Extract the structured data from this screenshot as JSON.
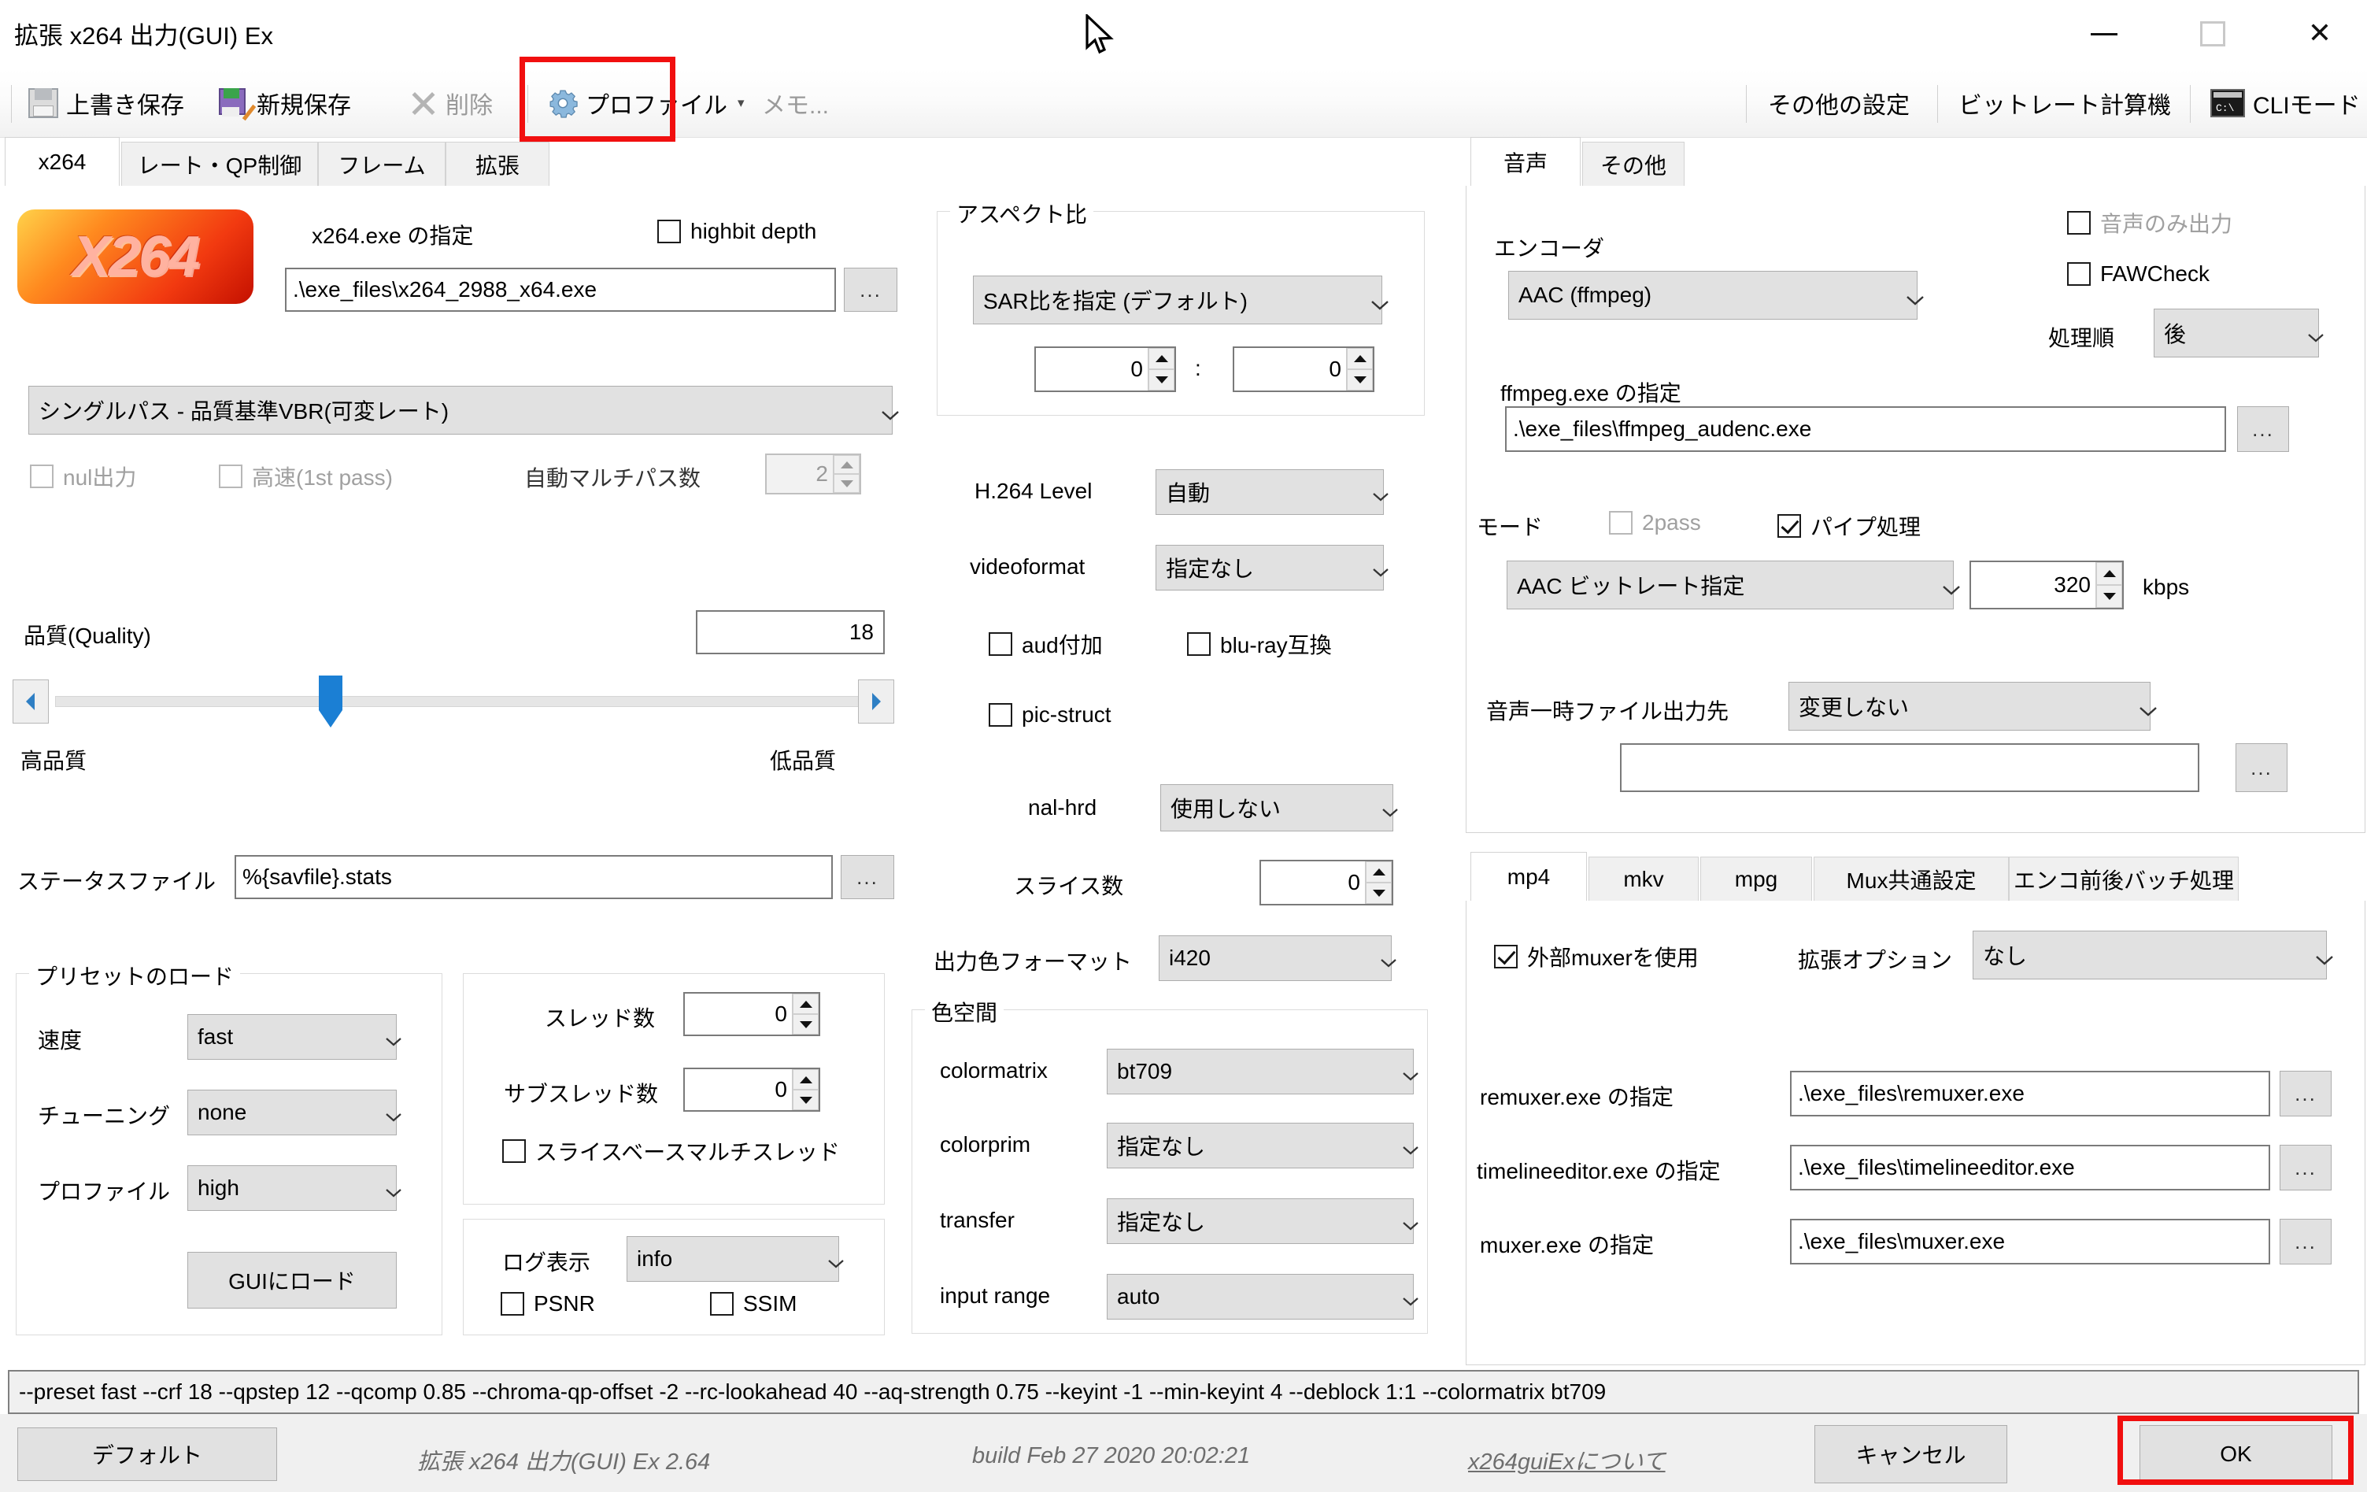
{
  "window": {
    "title": "拡張 x264 出力(GUI) Ex",
    "minimize_label": "",
    "maximize_label": "",
    "close_label": "✕"
  },
  "toolbar": {
    "overwrite_save": "上書き保存",
    "new_save": "新規保存",
    "delete": "削除",
    "profile": "プロファイル",
    "profile_caret": "▾",
    "memo": "メモ...",
    "other_settings": "その他の設定",
    "bitrate_calculator": "ビットレート計算機",
    "cli_mode": "CLIモード",
    "cli_icon_text": "C:\\"
  },
  "main_tabs": [
    {
      "label": "x264",
      "active": true
    },
    {
      "label": "レート・QP制御",
      "active": false
    },
    {
      "label": "フレーム",
      "active": false
    },
    {
      "label": "拡張",
      "active": false
    }
  ],
  "x264_tab": {
    "exe_label": "x264.exe の指定",
    "highbit_depth": {
      "label": "highbit depth",
      "checked": false
    },
    "exe_path": ".\\exe_files\\x264_2988_x64.exe",
    "browse_label": "...",
    "mode_combo": "シングルパス - 品質基準VBR(可変レート)",
    "nul_output": {
      "label": "nul出力",
      "checked": false,
      "disabled": true
    },
    "fast_first_pass": {
      "label": "高速(1st pass)",
      "checked": false,
      "disabled": true
    },
    "auto_multipass_label": "自動マルチパス数",
    "auto_multipass_value": "2",
    "quality_label": "品質(Quality)",
    "quality_value": "18",
    "quality_high_label": "高品質",
    "quality_low_label": "低品質",
    "status_file_label": "ステータスファイル",
    "status_file_value": "%{savfile}.stats",
    "preset_group": {
      "title": "プリセットのロード",
      "speed_label": "速度",
      "speed_value": "fast",
      "tuning_label": "チューニング",
      "tuning_value": "none",
      "profile_label": "プロファイル",
      "profile_value": "high",
      "load_button": "GUIにロード"
    },
    "thread_group": {
      "threads_label": "スレッド数",
      "threads_value": "0",
      "subthreads_label": "サブスレッド数",
      "subthreads_value": "0",
      "slice_based_mt": {
        "label": "スライスベースマルチスレッド",
        "checked": false
      }
    },
    "log_group": {
      "log_label": "ログ表示",
      "log_value": "info",
      "psnr": {
        "label": "PSNR",
        "checked": false
      },
      "ssim": {
        "label": "SSIM",
        "checked": false
      }
    },
    "aspect_group": {
      "title": "アスペクト比",
      "sar_combo": "SAR比を指定 (デフォルト)",
      "sar_x": "0",
      "sar_separator": ":",
      "sar_y": "0"
    },
    "level_label": "H.264 Level",
    "level_value": "自動",
    "videoformat_label": "videoformat",
    "videoformat_value": "指定なし",
    "aud": {
      "label": "aud付加",
      "checked": false
    },
    "bluray": {
      "label": "blu-ray互換",
      "checked": false
    },
    "pic_struct": {
      "label": "pic-struct",
      "checked": false
    },
    "nal_hrd_label": "nal-hrd",
    "nal_hrd_value": "使用しない",
    "slices_label": "スライス数",
    "slices_value": "0",
    "out_colorformat_label": "出力色フォーマット",
    "out_colorformat_value": "i420",
    "colorspace_group": {
      "title": "色空間",
      "colormatrix_label": "colormatrix",
      "colormatrix_value": "bt709",
      "colorprim_label": "colorprim",
      "colorprim_value": "指定なし",
      "transfer_label": "transfer",
      "transfer_value": "指定なし",
      "input_range_label": "input range",
      "input_range_value": "auto"
    }
  },
  "audio_tabs": [
    {
      "label": "音声",
      "active": true
    },
    {
      "label": "その他",
      "active": false
    }
  ],
  "audio_tab": {
    "encoder_label": "エンコーダ",
    "encoder_value": "AAC (ffmpeg)",
    "audio_only": {
      "label": "音声のみ出力",
      "checked": false,
      "disabled": true
    },
    "fawcheck": {
      "label": "FAWCheck",
      "checked": false
    },
    "order_label": "処理順",
    "order_value": "後",
    "ffmpeg_label": "ffmpeg.exe の指定",
    "ffmpeg_path": ".\\exe_files\\ffmpeg_audenc.exe",
    "browse_label": "...",
    "mode_label": "モード",
    "twopass": {
      "label": "2pass",
      "checked": false,
      "disabled": true
    },
    "pipe": {
      "label": "パイプ処理",
      "checked": true
    },
    "bitrate_mode": "AAC ビットレート指定",
    "bitrate_value": "320",
    "bitrate_unit": "kbps",
    "temp_dir_label": "音声一時ファイル出力先",
    "temp_dir_value": "変更しない",
    "temp_path_value": ""
  },
  "mux_tabs": [
    {
      "label": "mp4",
      "active": true
    },
    {
      "label": "mkv",
      "active": false
    },
    {
      "label": "mpg",
      "active": false
    },
    {
      "label": "Mux共通設定",
      "active": false
    },
    {
      "label": "エンコ前後バッチ処理",
      "active": false
    }
  ],
  "mux_tab": {
    "use_external_muxer": {
      "label": "外部muxerを使用",
      "checked": true
    },
    "ext_option_label": "拡張オプション",
    "ext_option_value": "なし",
    "remuxer_label": "remuxer.exe の指定",
    "remuxer_path": ".\\exe_files\\remuxer.exe",
    "timelineeditor_label": "timelineeditor.exe の指定",
    "timelineeditor_path": ".\\exe_files\\timelineeditor.exe",
    "muxer_label": "muxer.exe の指定",
    "muxer_path": ".\\exe_files\\muxer.exe",
    "browse_label": "..."
  },
  "command_line": "--preset fast --crf 18 --qpstep 12 --qcomp 0.85 --chroma-qp-offset -2 --rc-lookahead 40 --aq-strength 0.75 --keyint -1 --min-keyint 4 --deblock 1:1 --colormatrix bt709",
  "bottom": {
    "defaults_button": "デフォルト",
    "version_text": "拡張 x264 出力(GUI) Ex 2.64",
    "build_text": "build Feb 27 2020 20:02:21",
    "about_link": "x264guiExについて",
    "cancel_button": "キャンセル",
    "ok_button": "OK"
  },
  "colors": {
    "highlight": "#f10f0f",
    "slider_thumb": "#1b7fd4",
    "panel_bg": "#ffffff",
    "control_bg": "#e1e1e1",
    "bottom_bg": "#f0f0f0"
  }
}
